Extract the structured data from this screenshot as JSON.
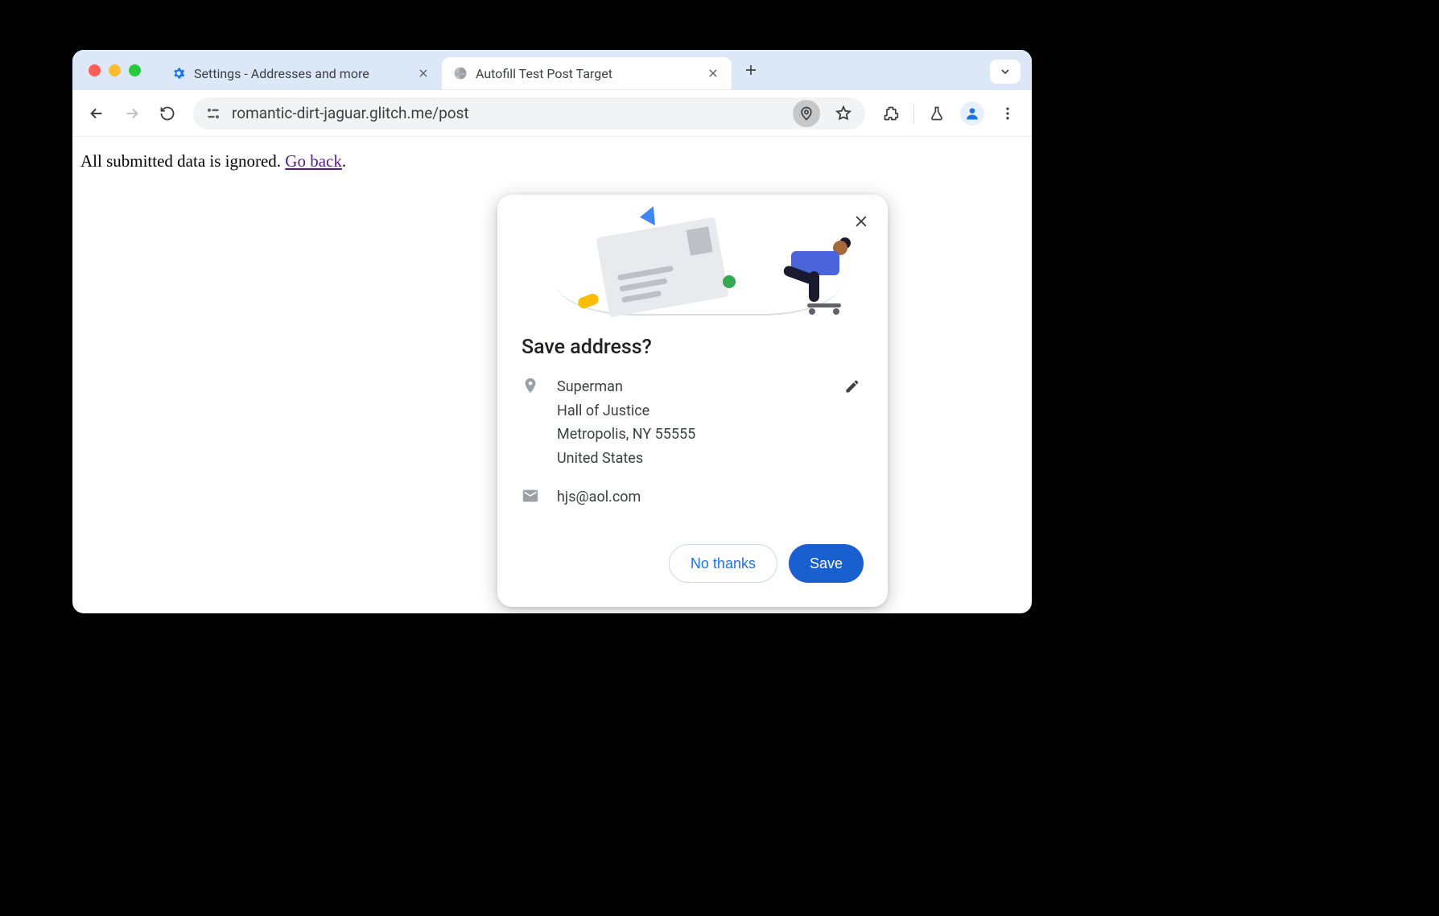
{
  "tabs": [
    {
      "title": "Settings - Addresses and more",
      "favicon": "gear-blue",
      "active": false
    },
    {
      "title": "Autofill Test Post Target",
      "favicon": "globe",
      "active": true
    }
  ],
  "url": "romantic-dirt-jaguar.glitch.me/post",
  "page": {
    "text_prefix": "All submitted data is ignored. ",
    "link_text": "Go back",
    "text_suffix": "."
  },
  "popup": {
    "title": "Save address?",
    "address": {
      "name": "Superman",
      "line1": "Hall of Justice",
      "line2": "Metropolis, NY 55555",
      "country": "United States"
    },
    "email": "hjs@aol.com",
    "buttons": {
      "secondary": "No thanks",
      "primary": "Save"
    }
  }
}
